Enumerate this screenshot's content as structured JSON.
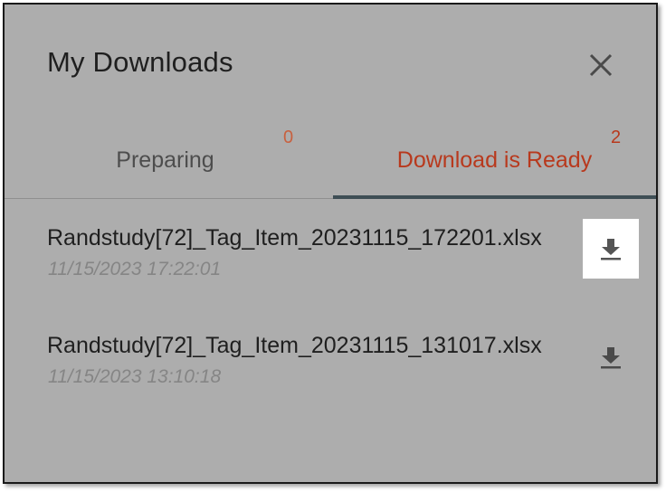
{
  "dialog": {
    "title": "My Downloads",
    "close_icon": "close-icon"
  },
  "tabs": [
    {
      "label": "Preparing",
      "count": "0",
      "active": false
    },
    {
      "label": "Download is Ready",
      "count": "2",
      "active": true
    }
  ],
  "files": [
    {
      "name": "Randstudy[72]_Tag_Item_20231115_172201.xlsx",
      "date": "11/15/2023 17:22:01",
      "icon": "download-icon",
      "highlighted": true
    },
    {
      "name": "Randstudy[72]_Tag_Item_20231115_131017.xlsx",
      "date": "11/15/2023 13:10:18",
      "icon": "download-icon",
      "highlighted": false
    }
  ],
  "colors": {
    "panel_bg": "#adadad",
    "active_tab_text": "#b8391d",
    "tab_indicator": "#3e4e55"
  }
}
